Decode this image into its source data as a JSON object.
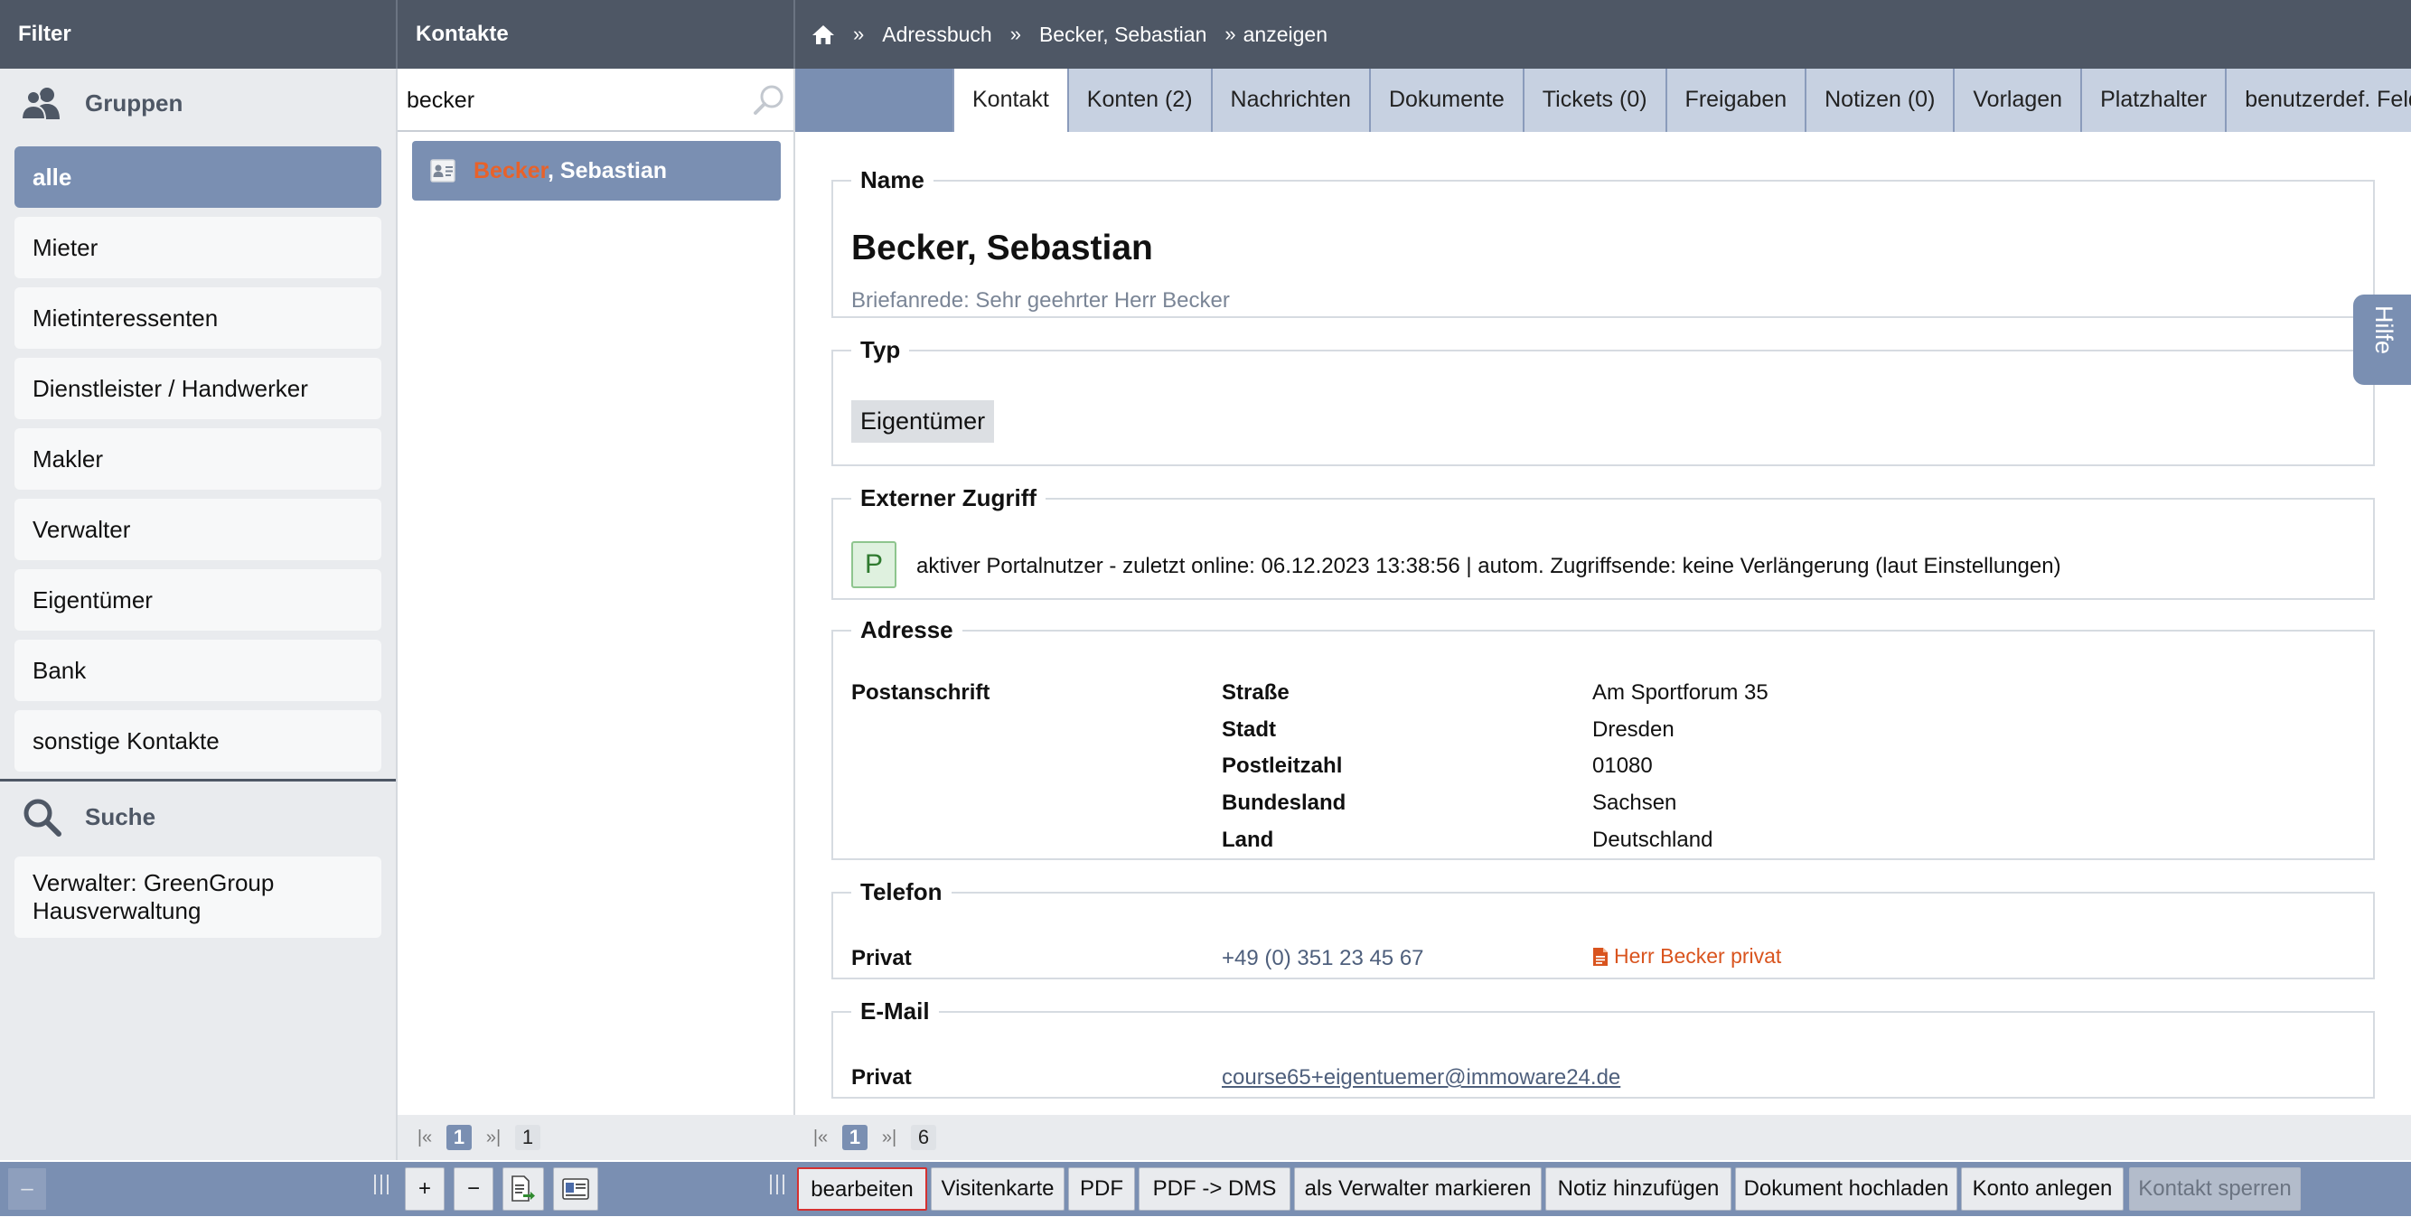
{
  "header": {
    "filter_title": "Filter",
    "contacts_title": "Kontakte",
    "breadcrumb": [
      "Adressbuch",
      "Becker, Sebastian",
      "anzeigen"
    ],
    "crumb_sep": "»"
  },
  "groups": {
    "title": "Gruppen",
    "items": [
      "alle",
      "Mieter",
      "Mietinteressenten",
      "Dienstleister / Handwerker",
      "Makler",
      "Verwalter",
      "Eigentümer",
      "Bank",
      "sonstige Kontakte"
    ],
    "active_index": 0
  },
  "search": {
    "title": "Suche",
    "saved": "Verwalter: GreenGroup Hausverwaltung"
  },
  "contacts": {
    "query": "becker",
    "result": {
      "highlight": "Becker",
      "rest": ", Sebastian"
    },
    "pager": {
      "first": "|«",
      "page": "1",
      "last": "»|",
      "count": "1"
    }
  },
  "tabs": [
    "Kontakt",
    "Konten (2)",
    "Nachrichten",
    "Dokumente",
    "Tickets (0)",
    "Freigaben",
    "Notizen (0)",
    "Vorlagen",
    "Platzhalter",
    "benutzerdef. Felder"
  ],
  "active_tab": 0,
  "detail": {
    "name_legend": "Name",
    "full_name": "Becker, Sebastian",
    "salutation": "Briefanrede: Sehr geehrter Herr Becker",
    "type_legend": "Typ",
    "type": "Eigentümer",
    "access_legend": "Externer Zugriff",
    "portal_badge": "P",
    "portal_text": "aktiver Portalnutzer - zuletzt online: 06.12.2023 13:38:56 | autom. Zugriffsende: keine Verlängerung (laut Einstellungen)",
    "address_legend": "Adresse",
    "address_kind": "Postanschrift",
    "address": [
      {
        "label": "Straße",
        "value": "Am Sportforum 35"
      },
      {
        "label": "Stadt",
        "value": "Dresden"
      },
      {
        "label": "Postleitzahl",
        "value": "01080"
      },
      {
        "label": "Bundesland",
        "value": "Sachsen"
      },
      {
        "label": "Land",
        "value": "Deutschland"
      }
    ],
    "phone_legend": "Telefon",
    "phone_kind": "Privat",
    "phone": "+49 (0) 351 23 45 67",
    "phone_note": "Herr Becker privat",
    "email_legend": "E-Mail",
    "email_kind": "Privat",
    "email": "course65+eigentuemer@immoware24.de"
  },
  "main_pager": {
    "first": "|«",
    "page": "1",
    "last": "»|",
    "count": "6"
  },
  "help_tab": "Hilfe",
  "bottom": {
    "collapse": "–",
    "plus": "+",
    "minus": "−",
    "actions": [
      "bearbeiten",
      "Visitenkarte",
      "PDF",
      "PDF -> DMS",
      "als Verwalter markieren",
      "Notiz hinzufügen",
      "Dokument hochladen",
      "Konto anlegen",
      "Kontakt sperren"
    ]
  },
  "colors": {
    "header_bg": "#4e5765",
    "accent": "#7a8fb2",
    "highlight": "#e8622a",
    "selected_outline": "#d43030"
  }
}
